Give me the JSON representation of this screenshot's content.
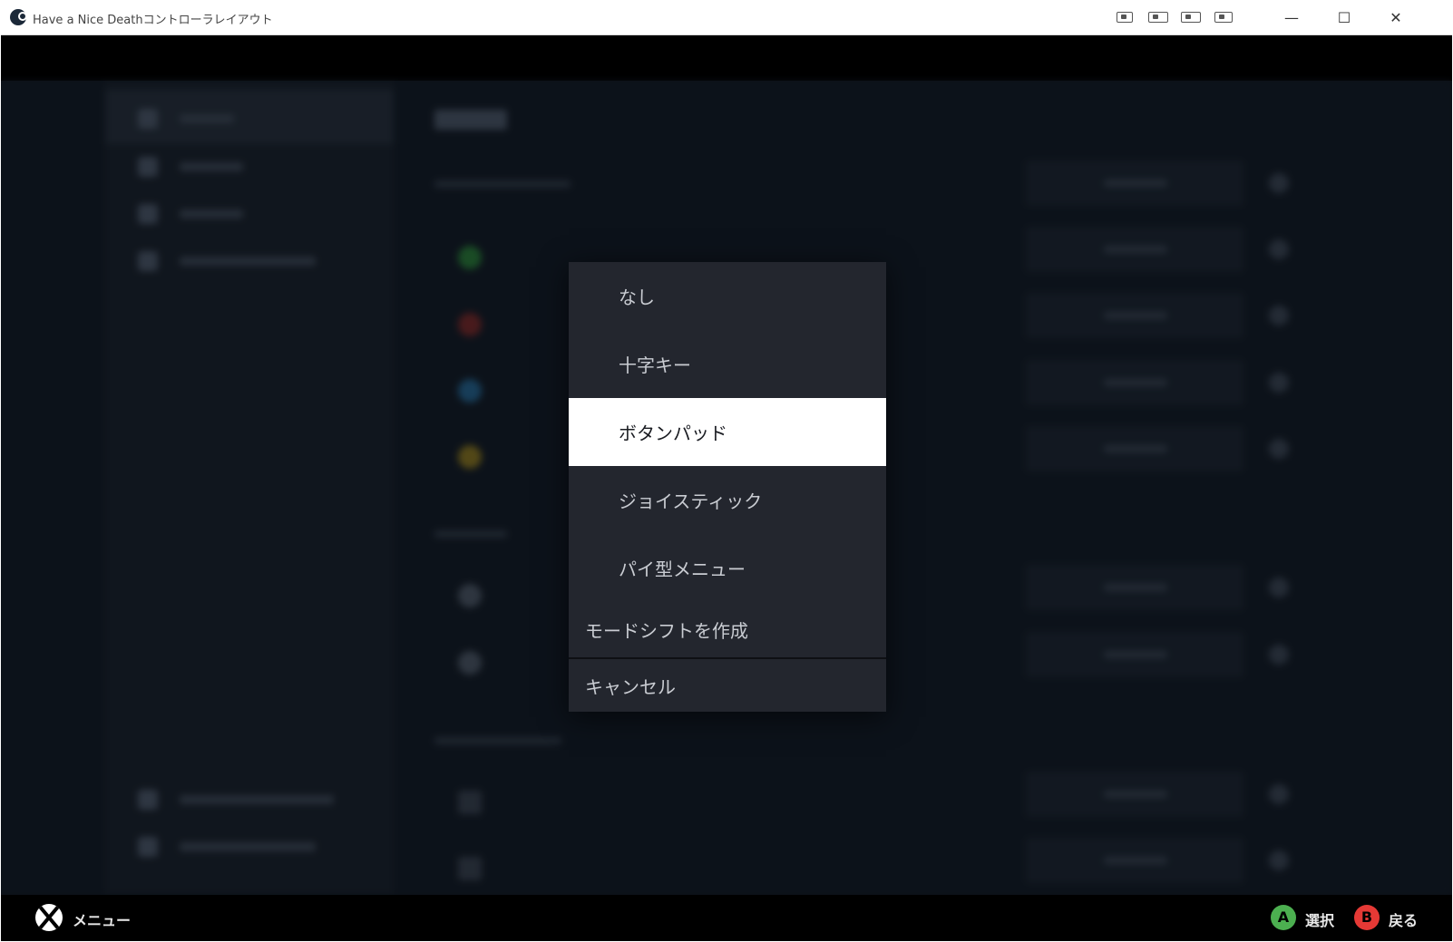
{
  "window": {
    "title": "Have a Nice Deathコントローラレイアウト"
  },
  "titlebar_icons": [
    "screenshot-icon",
    "controller-icon",
    "controller-layout-icon",
    "cast-icon"
  ],
  "window_controls": {
    "minimize": "—",
    "maximize": "☐",
    "close": "✕"
  },
  "dropdown": {
    "options": [
      {
        "label": "なし",
        "selected": false
      },
      {
        "label": "十字キー",
        "selected": false
      },
      {
        "label": "ボタンパッド",
        "selected": true
      },
      {
        "label": "ジョイスティック",
        "selected": false
      },
      {
        "label": "パイ型メニュー",
        "selected": false
      }
    ],
    "create_mode_shift": "モードシフトを作成",
    "cancel": "キャンセル"
  },
  "bottom_bar": {
    "menu_label": "メニュー",
    "a_glyph": "A",
    "a_label": "選択",
    "a_color": "#4caf50",
    "b_glyph": "B",
    "b_label": "戻る",
    "b_color": "#e53935"
  }
}
